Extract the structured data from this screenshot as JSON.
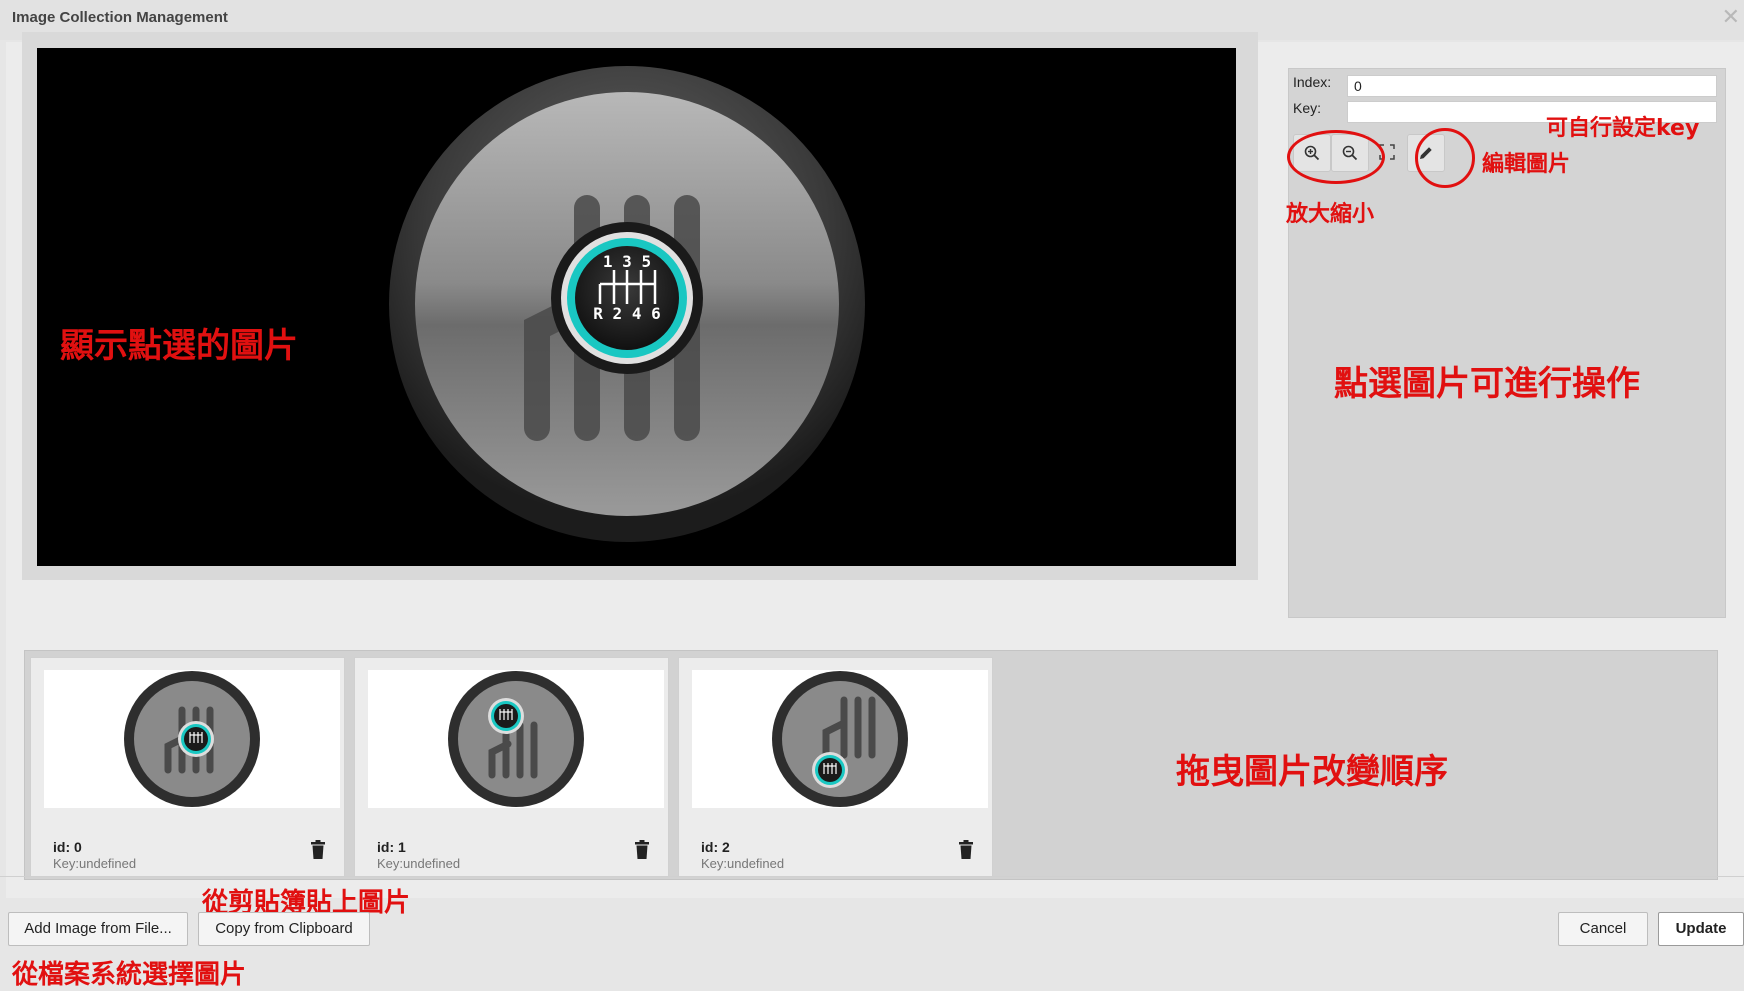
{
  "dialog": {
    "title": "Image Collection Management",
    "close_icon": "close-icon"
  },
  "sidebar": {
    "index_label": "Index:",
    "index_value": "0",
    "key_label": "Key:",
    "key_value": ""
  },
  "toolbar": {
    "tools": [
      "zoom-in-icon",
      "zoom-out-icon",
      "fullscreen-icon",
      "pencil-icon"
    ]
  },
  "preview": {
    "upper_gears": "1 3 5",
    "lower_gears": "R 2 4 6"
  },
  "annotations": {
    "display_selected": "顯示點選的圖片",
    "set_key": "可自行設定key",
    "edit_image": "編輯圖片",
    "zoom": "放大縮小",
    "click_to_operate": "點選圖片可進行操作",
    "drag_reorder": "拖曳圖片改變順序",
    "paste_clipboard": "從剪貼簿貼上圖片",
    "choose_file": "從檔案系統選擇圖片"
  },
  "thumbnails": [
    {
      "id": "id: 0",
      "key": "Key:undefined"
    },
    {
      "id": "id: 1",
      "key": "Key:undefined"
    },
    {
      "id": "id: 2",
      "key": "Key:undefined"
    }
  ],
  "buttons": {
    "add_file": "Add Image from File...",
    "clipboard": "Copy from Clipboard",
    "cancel": "Cancel",
    "update": "Update"
  },
  "colors": {
    "annotation": "#e11010",
    "knob_accent": "#19c7c2"
  }
}
